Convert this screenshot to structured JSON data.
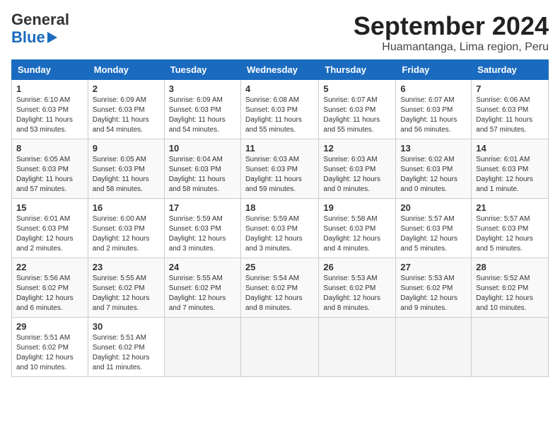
{
  "header": {
    "logo_line1": "General",
    "logo_line2": "Blue",
    "title": "September 2024",
    "subtitle": "Huamantanga, Lima region, Peru"
  },
  "calendar": {
    "days_of_week": [
      "Sunday",
      "Monday",
      "Tuesday",
      "Wednesday",
      "Thursday",
      "Friday",
      "Saturday"
    ],
    "weeks": [
      [
        {
          "day": "1",
          "info": "Sunrise: 6:10 AM\nSunset: 6:03 PM\nDaylight: 11 hours\nand 53 minutes."
        },
        {
          "day": "2",
          "info": "Sunrise: 6:09 AM\nSunset: 6:03 PM\nDaylight: 11 hours\nand 54 minutes."
        },
        {
          "day": "3",
          "info": "Sunrise: 6:09 AM\nSunset: 6:03 PM\nDaylight: 11 hours\nand 54 minutes."
        },
        {
          "day": "4",
          "info": "Sunrise: 6:08 AM\nSunset: 6:03 PM\nDaylight: 11 hours\nand 55 minutes."
        },
        {
          "day": "5",
          "info": "Sunrise: 6:07 AM\nSunset: 6:03 PM\nDaylight: 11 hours\nand 55 minutes."
        },
        {
          "day": "6",
          "info": "Sunrise: 6:07 AM\nSunset: 6:03 PM\nDaylight: 11 hours\nand 56 minutes."
        },
        {
          "day": "7",
          "info": "Sunrise: 6:06 AM\nSunset: 6:03 PM\nDaylight: 11 hours\nand 57 minutes."
        }
      ],
      [
        {
          "day": "8",
          "info": "Sunrise: 6:05 AM\nSunset: 6:03 PM\nDaylight: 11 hours\nand 57 minutes."
        },
        {
          "day": "9",
          "info": "Sunrise: 6:05 AM\nSunset: 6:03 PM\nDaylight: 11 hours\nand 58 minutes."
        },
        {
          "day": "10",
          "info": "Sunrise: 6:04 AM\nSunset: 6:03 PM\nDaylight: 11 hours\nand 58 minutes."
        },
        {
          "day": "11",
          "info": "Sunrise: 6:03 AM\nSunset: 6:03 PM\nDaylight: 11 hours\nand 59 minutes."
        },
        {
          "day": "12",
          "info": "Sunrise: 6:03 AM\nSunset: 6:03 PM\nDaylight: 12 hours\nand 0 minutes."
        },
        {
          "day": "13",
          "info": "Sunrise: 6:02 AM\nSunset: 6:03 PM\nDaylight: 12 hours\nand 0 minutes."
        },
        {
          "day": "14",
          "info": "Sunrise: 6:01 AM\nSunset: 6:03 PM\nDaylight: 12 hours\nand 1 minute."
        }
      ],
      [
        {
          "day": "15",
          "info": "Sunrise: 6:01 AM\nSunset: 6:03 PM\nDaylight: 12 hours\nand 2 minutes."
        },
        {
          "day": "16",
          "info": "Sunrise: 6:00 AM\nSunset: 6:03 PM\nDaylight: 12 hours\nand 2 minutes."
        },
        {
          "day": "17",
          "info": "Sunrise: 5:59 AM\nSunset: 6:03 PM\nDaylight: 12 hours\nand 3 minutes."
        },
        {
          "day": "18",
          "info": "Sunrise: 5:59 AM\nSunset: 6:03 PM\nDaylight: 12 hours\nand 3 minutes."
        },
        {
          "day": "19",
          "info": "Sunrise: 5:58 AM\nSunset: 6:03 PM\nDaylight: 12 hours\nand 4 minutes."
        },
        {
          "day": "20",
          "info": "Sunrise: 5:57 AM\nSunset: 6:03 PM\nDaylight: 12 hours\nand 5 minutes."
        },
        {
          "day": "21",
          "info": "Sunrise: 5:57 AM\nSunset: 6:03 PM\nDaylight: 12 hours\nand 5 minutes."
        }
      ],
      [
        {
          "day": "22",
          "info": "Sunrise: 5:56 AM\nSunset: 6:02 PM\nDaylight: 12 hours\nand 6 minutes."
        },
        {
          "day": "23",
          "info": "Sunrise: 5:55 AM\nSunset: 6:02 PM\nDaylight: 12 hours\nand 7 minutes."
        },
        {
          "day": "24",
          "info": "Sunrise: 5:55 AM\nSunset: 6:02 PM\nDaylight: 12 hours\nand 7 minutes."
        },
        {
          "day": "25",
          "info": "Sunrise: 5:54 AM\nSunset: 6:02 PM\nDaylight: 12 hours\nand 8 minutes."
        },
        {
          "day": "26",
          "info": "Sunrise: 5:53 AM\nSunset: 6:02 PM\nDaylight: 12 hours\nand 8 minutes."
        },
        {
          "day": "27",
          "info": "Sunrise: 5:53 AM\nSunset: 6:02 PM\nDaylight: 12 hours\nand 9 minutes."
        },
        {
          "day": "28",
          "info": "Sunrise: 5:52 AM\nSunset: 6:02 PM\nDaylight: 12 hours\nand 10 minutes."
        }
      ],
      [
        {
          "day": "29",
          "info": "Sunrise: 5:51 AM\nSunset: 6:02 PM\nDaylight: 12 hours\nand 10 minutes."
        },
        {
          "day": "30",
          "info": "Sunrise: 5:51 AM\nSunset: 6:02 PM\nDaylight: 12 hours\nand 11 minutes."
        },
        {
          "day": "",
          "info": ""
        },
        {
          "day": "",
          "info": ""
        },
        {
          "day": "",
          "info": ""
        },
        {
          "day": "",
          "info": ""
        },
        {
          "day": "",
          "info": ""
        }
      ]
    ]
  }
}
